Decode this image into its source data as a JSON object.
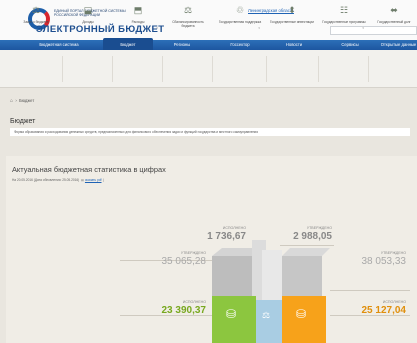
{
  "header": {
    "logo_small_line1": "ЕДИНЫЙ ПОРТАЛ БЮДЖЕТНОЙ СИСТЕМЫ",
    "logo_small_line2": "РОССИЙСКОЙ ФЕДЕРАЦИИ",
    "logo_title": "ЭЛЕКТРОННЫЙ БЮДЖЕТ",
    "region_link": "Ленинградская область"
  },
  "nav": {
    "items": [
      "Бюджетная система",
      "Бюджет",
      "Регионы",
      "Госсектор",
      "Новости",
      "Сервисы",
      "Открытые данные"
    ],
    "active": "Бюджет"
  },
  "iconbar": {
    "items": [
      {
        "label": "Закон о бюджете",
        "icon": "law-icon",
        "glyph": "⚖"
      },
      {
        "label": "Доходы",
        "icon": "income-icon",
        "glyph": "⬓"
      },
      {
        "label": "Расходы",
        "icon": "expense-icon",
        "glyph": "⬒"
      },
      {
        "label": "Сбалансированность бюджета",
        "icon": "balance-icon",
        "glyph": "⚖"
      },
      {
        "label": "Государственная поддержка",
        "icon": "support-icon",
        "glyph": "♲"
      },
      {
        "label": "Государственные инвестиции",
        "icon": "investment-icon",
        "glyph": "⬍"
      },
      {
        "label": "Государственные программы",
        "icon": "program-icon",
        "glyph": "☷"
      },
      {
        "label": "Государственный долг",
        "icon": "debt-icon",
        "glyph": "⬌"
      }
    ]
  },
  "breadcrumb": {
    "home_glyph": "⌂",
    "separator": "›",
    "current": "Бюджет"
  },
  "section": {
    "title": "Бюджет",
    "description": "Форма образования и расходования денежных средств, предназначенных для финансового обеспечения задач и функций государства и местного самоуправления"
  },
  "stats": {
    "title": "Актуальная бюджетная статистика в цифрах",
    "date_text": "На 20.05.2016 (Дата обновления: 25.05.2016)",
    "download_link": "скачать pdf",
    "left_approved_caption": "УТВЕРЖДЕНО",
    "left_approved_value": "35 065,28",
    "left_executed_caption": "ИСПОЛНЕНО",
    "left_executed_value": "23 390,37",
    "mid_executed_caption": "ИСПОЛНЕНО",
    "mid_executed_value": "1 736,67",
    "mid_approved_caption": "УТВЕРЖДЕНО",
    "mid_approved_value": "2 988,05",
    "right_approved_caption": "УТВЕРЖДЕНО",
    "right_approved_value": "38 053,33",
    "right_executed_caption": "ИСПОЛНЕНО",
    "right_executed_value": "25 127,04",
    "accent_green": "#8cc63f",
    "accent_orange": "#f7a21a",
    "accent_blue": "#a9cde3"
  }
}
